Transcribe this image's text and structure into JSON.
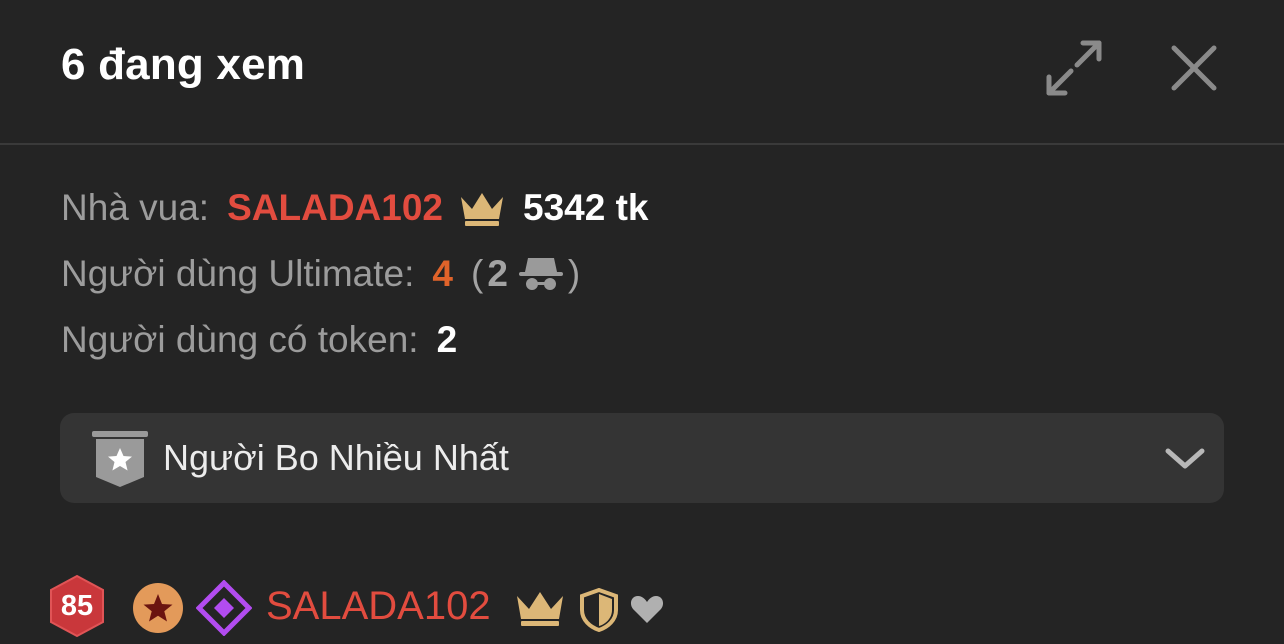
{
  "header": {
    "title": "6 đang xem",
    "expand_icon": "expand-arrows-icon",
    "close_icon": "close-icon"
  },
  "stats": {
    "king_label": "Nhà vua:",
    "king_name": "SALADA102",
    "king_tokens": "5342 tk",
    "ultimate_label": "Người dùng Ultimate:",
    "ultimate_count": "4",
    "incognito_open": "(",
    "incognito_count": "2",
    "incognito_close": ")",
    "token_users_label": "Người dùng có token:",
    "token_users_count": "2"
  },
  "dropdown": {
    "selected": "Người Bo Nhiều Nhất",
    "icon": "star-badge-icon"
  },
  "users": [
    {
      "level": "85",
      "name": "SALADA102",
      "badges": [
        "star-badge-icon",
        "diamond-badge-icon",
        "crown-icon",
        "shield-icon",
        "heart-icon"
      ]
    }
  ],
  "colors": {
    "background": "#242424",
    "king_red": "#e24c3f",
    "ultimate_orange": "#e0632a",
    "crown_gold": "#dcb777",
    "diamond_purple": "#b24cf0",
    "dropdown_bg": "#343434"
  }
}
